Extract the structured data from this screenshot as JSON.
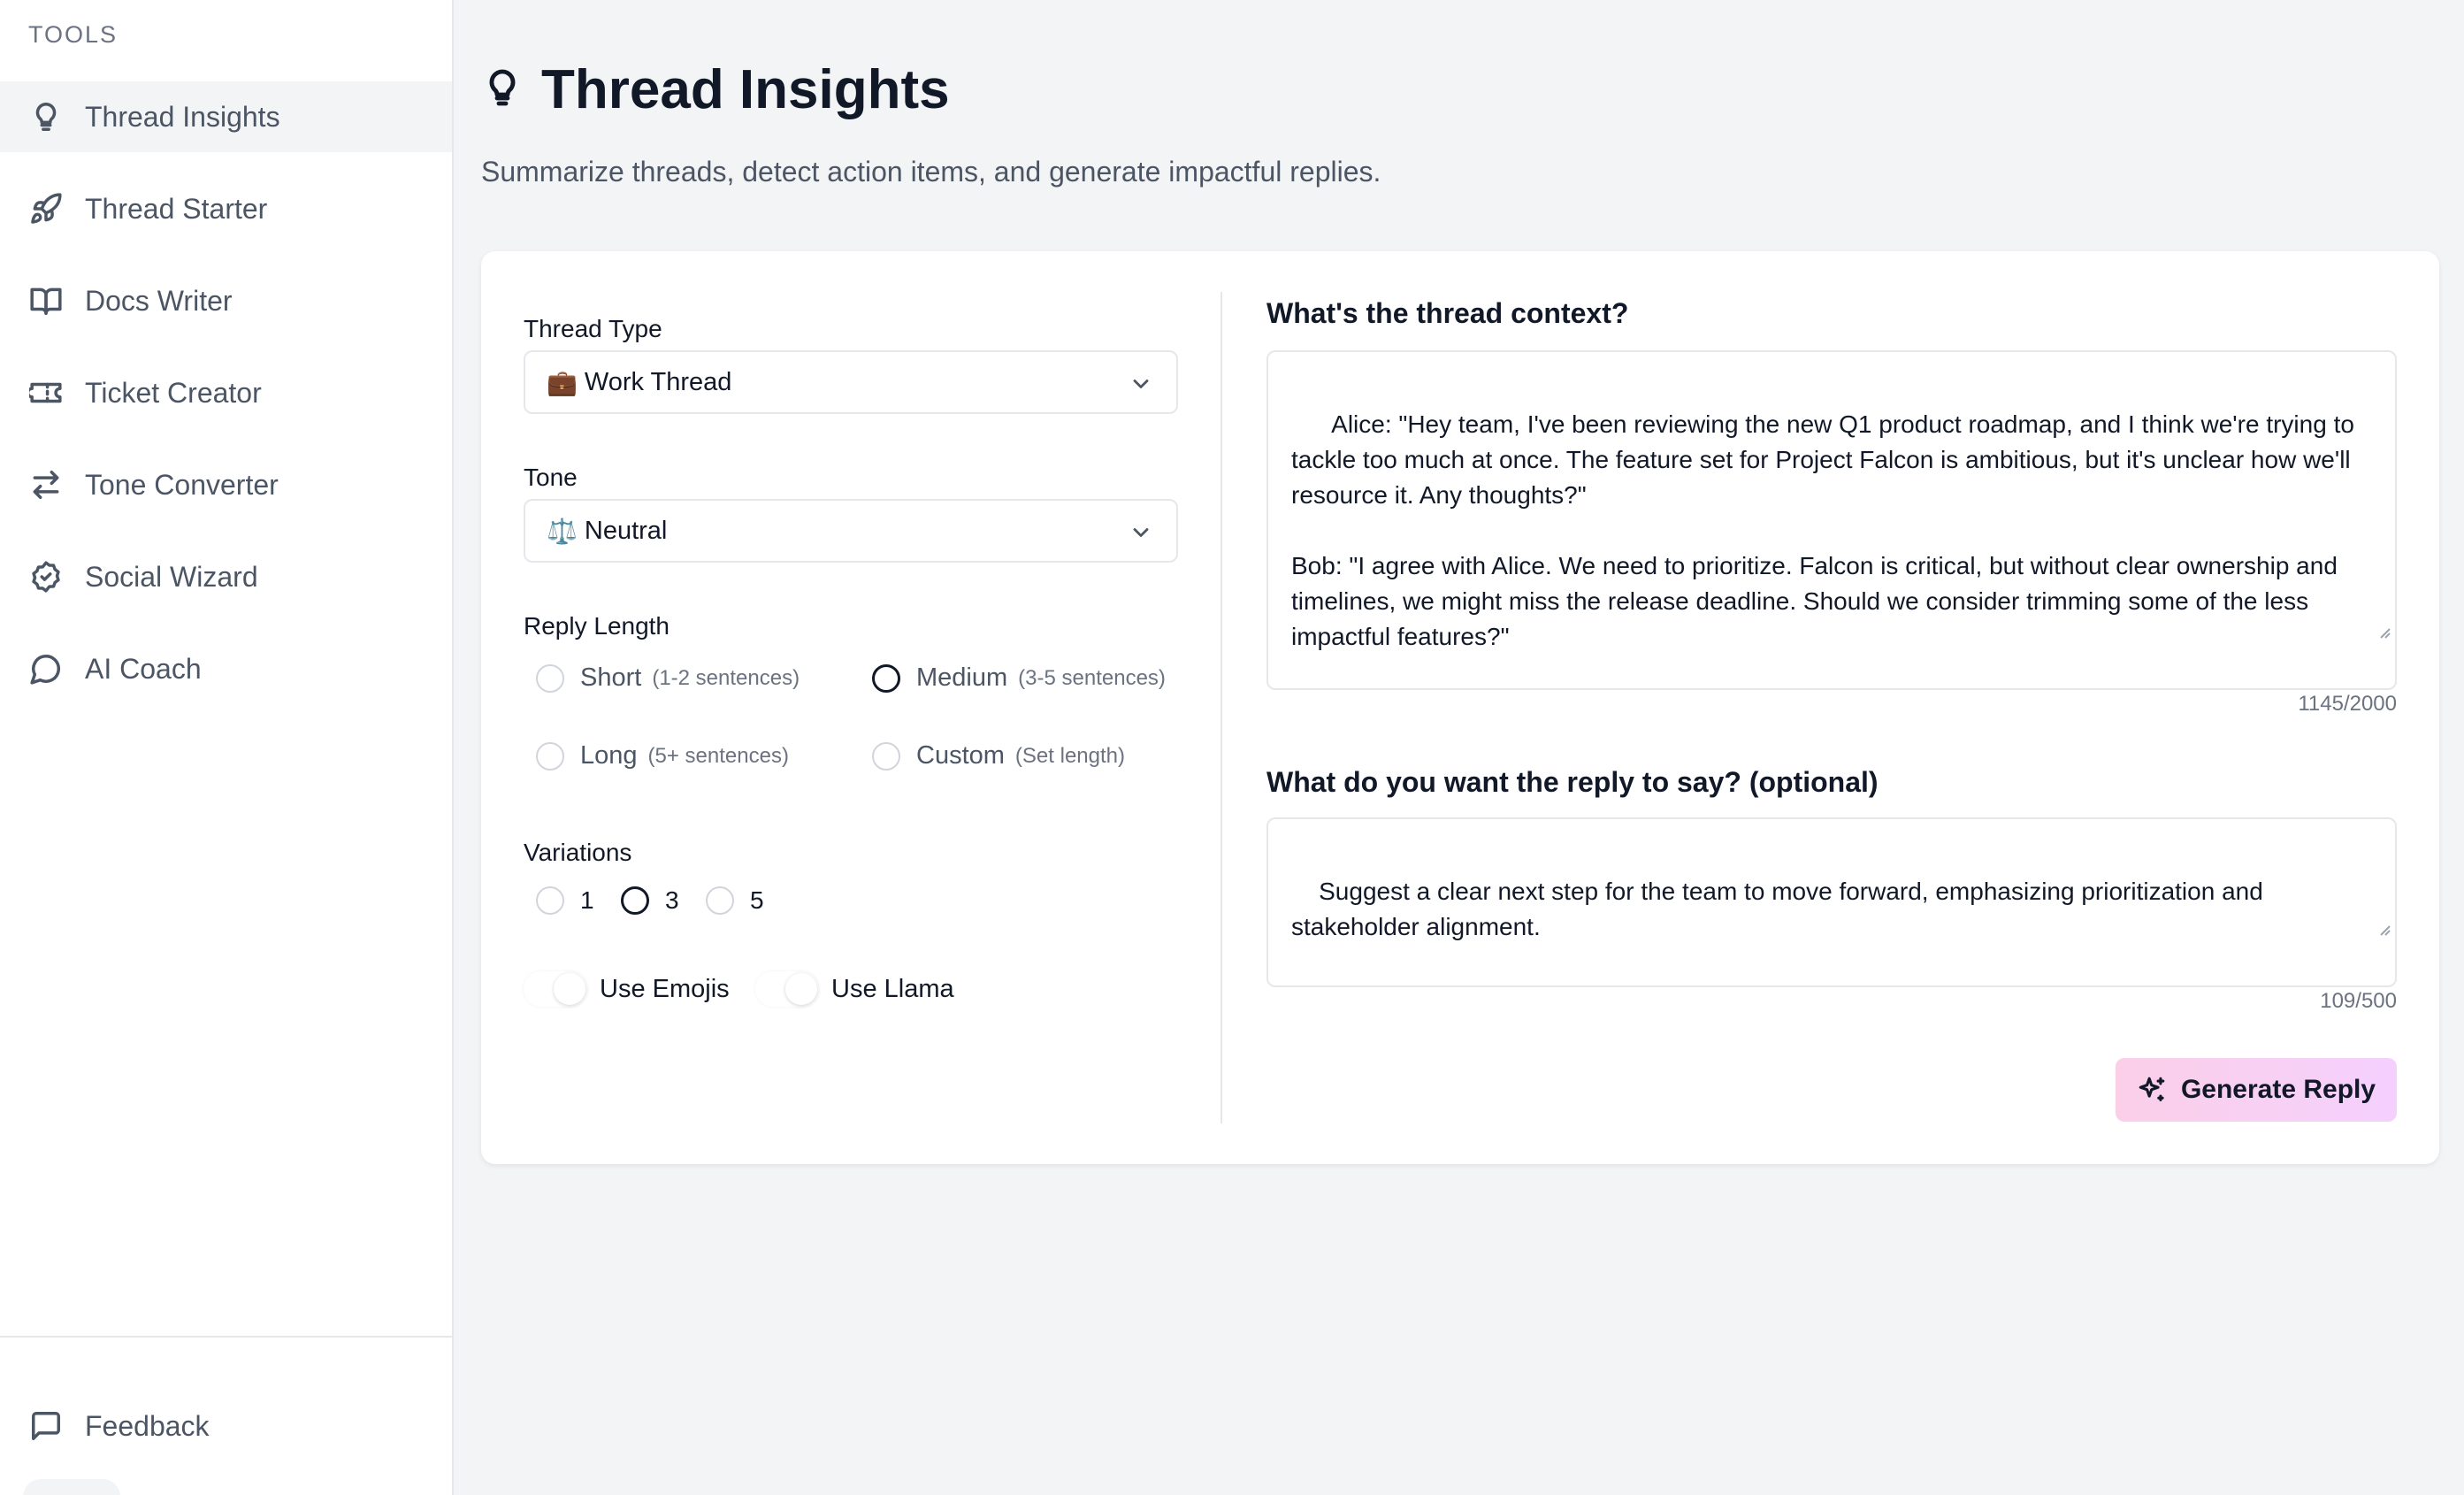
{
  "sidebar": {
    "heading": "TOOLS",
    "items": [
      {
        "label": "Thread Insights",
        "icon": "lightbulb-icon",
        "active": true
      },
      {
        "label": "Thread Starter",
        "icon": "rocket-icon"
      },
      {
        "label": "Docs Writer",
        "icon": "book-icon"
      },
      {
        "label": "Ticket Creator",
        "icon": "ticket-icon"
      },
      {
        "label": "Tone Converter",
        "icon": "arrows-swap-icon"
      },
      {
        "label": "Social Wizard",
        "icon": "badge-check-icon"
      },
      {
        "label": "AI Coach",
        "icon": "chat-bubble-icon"
      }
    ],
    "footer": {
      "label": "Feedback",
      "icon": "message-square-icon"
    }
  },
  "header": {
    "title": "Thread Insights",
    "subtitle": "Summarize threads, detect action items, and generate impactful replies."
  },
  "form": {
    "thread_type": {
      "label": "Thread Type",
      "emoji": "💼",
      "value": "Work Thread"
    },
    "tone": {
      "label": "Tone",
      "emoji": "⚖️",
      "value": "Neutral"
    },
    "reply_length": {
      "label": "Reply Length",
      "options": [
        {
          "label": "Short",
          "hint": "(1-2 sentences)",
          "checked": false
        },
        {
          "label": "Medium",
          "hint": "(3-5 sentences)",
          "checked": true
        },
        {
          "label": "Long",
          "hint": "(5+ sentences)",
          "checked": false
        },
        {
          "label": "Custom",
          "hint": "(Set length)",
          "checked": false
        }
      ]
    },
    "variations": {
      "label": "Variations",
      "options": [
        {
          "label": "1",
          "checked": false
        },
        {
          "label": "3",
          "checked": true
        },
        {
          "label": "5",
          "checked": false
        }
      ]
    },
    "toggles": {
      "emojis": {
        "label": "Use Emojis",
        "on": false
      },
      "llama": {
        "label": "Use Llama",
        "on": false
      }
    }
  },
  "context": {
    "heading": "What's the thread context?",
    "value": "  Alice: \"Hey team, I've been reviewing the new Q1 product roadmap, and I think we're trying to tackle too much at once. The feature set for Project Falcon is ambitious, but it's unclear how we'll resource it. Any thoughts?\"\n\nBob: \"I agree with Alice. We need to prioritize. Falcon is critical, but without clear ownership and timelines, we might miss the release deadline. Should we consider trimming some of the less impactful features?\"",
    "counter": "1145/2000"
  },
  "reply": {
    "heading": "What do you want the reply to say? (optional)",
    "value": "Suggest a clear next step for the team to move forward, emphasizing prioritization and stakeholder alignment.",
    "counter": "109/500"
  },
  "actions": {
    "generate_label": "Generate Reply",
    "generate_icon": "sparkles-icon",
    "button_gradient": [
      "#fbcfe8",
      "#f5d0fe"
    ]
  }
}
